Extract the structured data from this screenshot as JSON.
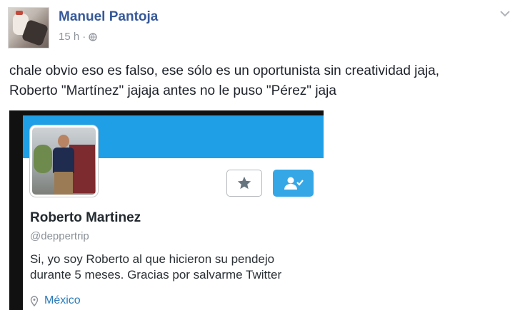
{
  "post": {
    "author": "Manuel Pantoja",
    "time": "15 h",
    "separator": "·",
    "privacy_icon": "globe-icon",
    "options_icon": "chevron-down-icon",
    "text_lines": [
      "chale obvio eso es falso, ese sólo es un oportunista sin creatividad jaja,",
      "Roberto \"Martínez\" jajaja antes no le puso \"Pérez\" jaja"
    ]
  },
  "twitter_card": {
    "display_name": "Roberto Martinez",
    "handle": "@deppertrip",
    "bio_lines": [
      "Si, yo soy Roberto al que hicieron su pendejo",
      "durante 5 meses. Gracias por salvarme Twitter"
    ],
    "location": "México",
    "favorite_icon": "star-icon",
    "follow_icon": "user-check-icon",
    "location_icon": "map-pin-icon"
  },
  "colors": {
    "author_link": "#365899",
    "twitter_blue": "#1e9fe6",
    "follow_button": "#35a7e7",
    "location_link": "#2b7bb9"
  }
}
